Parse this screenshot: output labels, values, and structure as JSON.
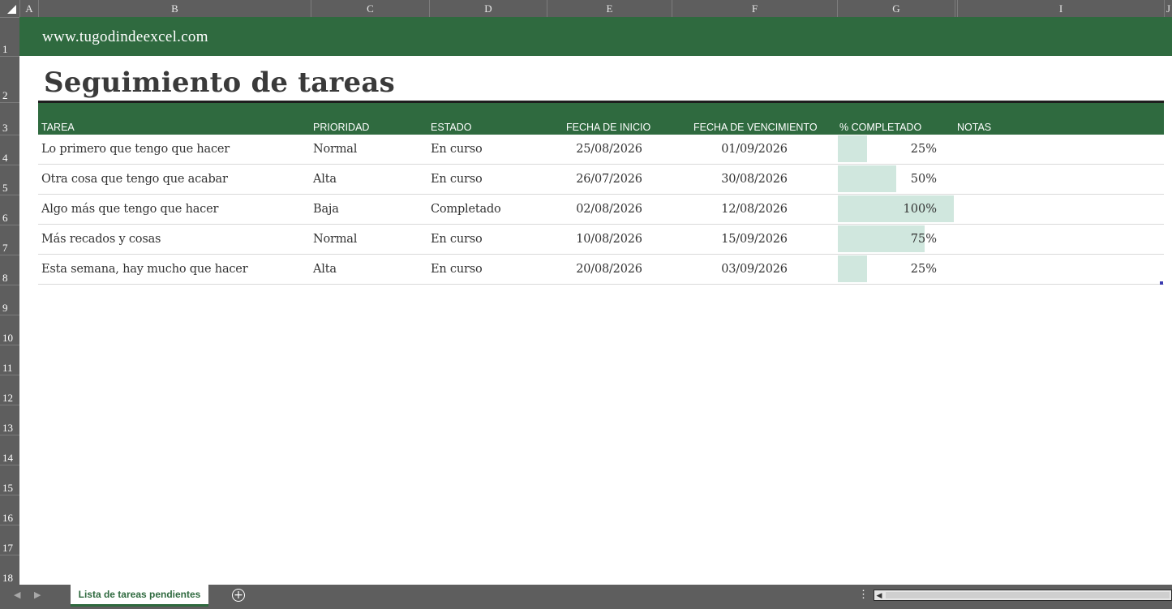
{
  "columns": [
    "A",
    "B",
    "C",
    "D",
    "E",
    "F",
    "G",
    "I",
    "J"
  ],
  "rows": [
    "1",
    "2",
    "3",
    "4",
    "5",
    "6",
    "7",
    "8",
    "9",
    "10",
    "11",
    "12",
    "13",
    "14",
    "15",
    "16",
    "17",
    "18"
  ],
  "banner": {
    "url": "www.tugodindeexcel.com"
  },
  "title": "Seguimiento de tareas",
  "table": {
    "headers": {
      "task": "TAREA",
      "priority": "PRIORIDAD",
      "status": "ESTADO",
      "start": "FECHA DE INICIO",
      "due": "FECHA DE VENCIMIENTO",
      "complete": "% COMPLETADO",
      "notes": "NOTAS"
    },
    "rows": [
      {
        "task": "Lo primero que tengo que hacer",
        "priority": "Normal",
        "status": "En curso",
        "start": "25/08/2026",
        "due": "01/09/2026",
        "complete": "25%",
        "complete_fraction": 0.25,
        "notes": ""
      },
      {
        "task": "Otra cosa que tengo que acabar",
        "priority": "Alta",
        "status": "En curso",
        "start": "26/07/2026",
        "due": "30/08/2026",
        "complete": "50%",
        "complete_fraction": 0.5,
        "notes": ""
      },
      {
        "task": "Algo más que tengo que hacer",
        "priority": "Baja",
        "status": "Completado",
        "start": "02/08/2026",
        "due": "12/08/2026",
        "complete": "100%",
        "complete_fraction": 1.0,
        "notes": ""
      },
      {
        "task": "Más recados y cosas",
        "priority": "Normal",
        "status": "En curso",
        "start": "10/08/2026",
        "due": "15/09/2026",
        "complete": "75%",
        "complete_fraction": 0.75,
        "notes": ""
      },
      {
        "task": "Esta semana, hay mucho que hacer",
        "priority": "Alta",
        "status": "En curso",
        "start": "20/08/2026",
        "due": "03/09/2026",
        "complete": "25%",
        "complete_fraction": 0.25,
        "notes": ""
      }
    ]
  },
  "sheet_tabs": [
    {
      "label": "Lista de tareas pendientes",
      "active": true
    }
  ],
  "colors": {
    "header_green": "#2f6a3f",
    "progress_fill": "#d0e7de",
    "chrome_gray": "#5e5e5e"
  },
  "icons": {
    "corner": "select-all-icon",
    "add_sheet": "plus-circle-icon",
    "scroll_left": "chevron-left-icon"
  }
}
